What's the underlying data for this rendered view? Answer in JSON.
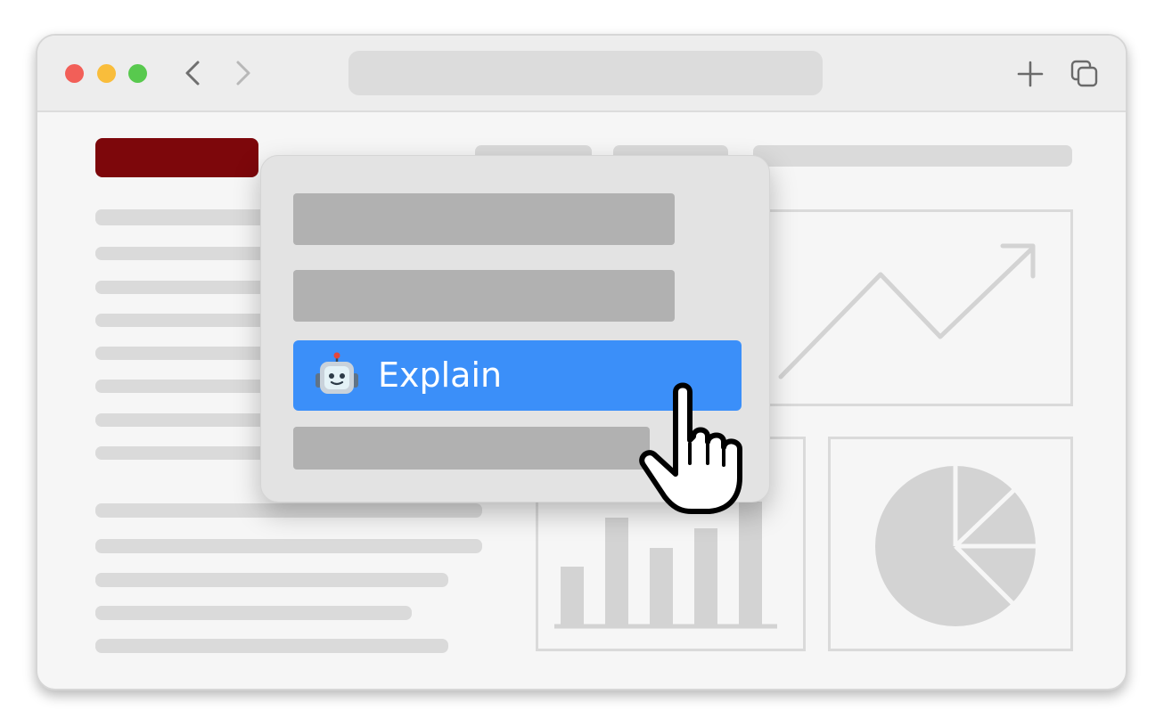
{
  "menu": {
    "explain_label": "Explain"
  },
  "icons": {
    "back": "chevron-left-icon",
    "forward": "chevron-right-icon",
    "new_tab": "plus-icon",
    "tab_overview": "tabs-icon",
    "assistant": "robot-icon",
    "pointer": "hand-pointer-icon",
    "line_chart": "line-chart-icon",
    "bar_chart": "bar-chart-icon",
    "pie_chart": "pie-chart-icon"
  },
  "colors": {
    "brand": "#7d070b",
    "highlight": "#3b8ff9",
    "traffic_red": "#f25f58",
    "traffic_yellow": "#f9bd3b",
    "traffic_green": "#58c94e"
  }
}
